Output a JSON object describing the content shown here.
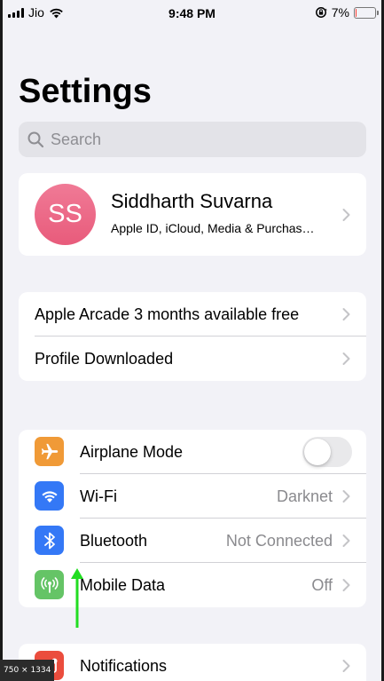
{
  "status_bar": {
    "carrier": "Jio",
    "time": "9:48 PM",
    "battery_percent": "7%",
    "battery_level": 0.07,
    "icons": [
      "signal-bars-icon",
      "wifi-icon",
      "orientation-lock-icon",
      "battery-icon"
    ]
  },
  "page": {
    "title": "Settings"
  },
  "search": {
    "placeholder": "Search",
    "icon": "search-icon"
  },
  "profile": {
    "initials": "SS",
    "name": "Siddharth Suvarna",
    "subtitle": "Apple ID, iCloud, Media & Purchas…"
  },
  "promo_items": [
    {
      "label": "Apple Arcade 3 months available free"
    },
    {
      "label": "Profile Downloaded"
    }
  ],
  "network_items": [
    {
      "label": "Airplane Mode",
      "icon": "airplane-icon",
      "icon_color": "#f09a37",
      "toggle_on": false
    },
    {
      "label": "Wi-Fi",
      "value": "Darknet",
      "icon": "wifi-icon",
      "icon_color": "#3478f6"
    },
    {
      "label": "Bluetooth",
      "value": "Not Connected",
      "icon": "bluetooth-icon",
      "icon_color": "#3478f6"
    },
    {
      "label": "Mobile Data",
      "value": "Off",
      "icon": "antenna-icon",
      "icon_color": "#65c466"
    }
  ],
  "notifications_item": {
    "label": "Notifications",
    "icon": "notifications-icon",
    "icon_color": "#eb4d3d"
  },
  "annotation": {
    "arrow_color": "#22dd22"
  },
  "image_badge": {
    "text": "750 × 1334"
  }
}
